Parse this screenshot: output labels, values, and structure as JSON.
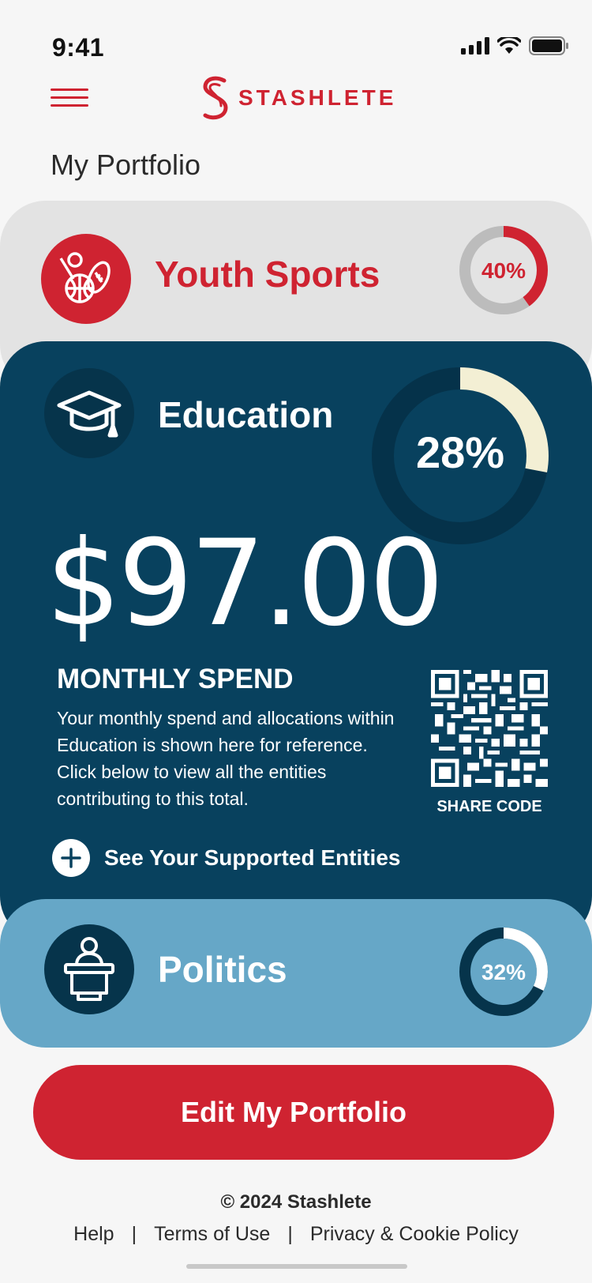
{
  "status": {
    "time": "9:41"
  },
  "brand": {
    "name": "STASHLETE",
    "accent": "#cf2331"
  },
  "page": {
    "title": "My Portfolio"
  },
  "categories": {
    "youth": {
      "title": "Youth Sports",
      "percent_label": "40%",
      "percent": 40,
      "icon": "sports-balls-icon",
      "color": "#cf2331"
    },
    "education": {
      "title": "Education",
      "percent_label": "28%",
      "percent": 28,
      "icon": "graduation-cap-icon",
      "amount": "$97.00",
      "spend_label": "MONTHLY SPEND",
      "description": "Your monthly spend and allocations within Education is shown here for reference. Click below to view all the entities contributing to this total.",
      "share_label": "SHARE CODE",
      "see_entities_label": "See Your Supported Entities",
      "color": "#08415e"
    },
    "politics": {
      "title": "Politics",
      "percent_label": "32%",
      "percent": 32,
      "icon": "podium-speaker-icon",
      "color": "#66a7c7"
    }
  },
  "actions": {
    "edit_label": "Edit My Portfolio"
  },
  "footer": {
    "copyright": "© 2024 Stashlete",
    "links": [
      "Help",
      "Terms of Use",
      "Privacy & Cookie Policy"
    ],
    "separator": "|"
  }
}
